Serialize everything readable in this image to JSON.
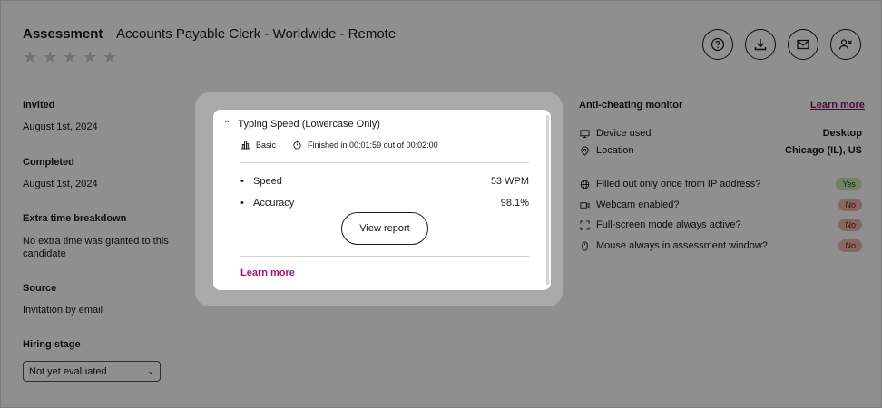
{
  "header": {
    "title": "Assessment",
    "subtitle": "Accounts Payable Clerk - Worldwide - Remote",
    "rating": {
      "value": 0,
      "max": 5
    }
  },
  "actions": [
    {
      "name": "help-icon"
    },
    {
      "name": "download-icon"
    },
    {
      "name": "mail-icon"
    },
    {
      "name": "remove-user-icon"
    }
  ],
  "left": {
    "invited_label": "Invited",
    "invited_value": "August 1st, 2024",
    "completed_label": "Completed",
    "completed_value": "August 1st, 2024",
    "extra_label": "Extra time breakdown",
    "extra_value": "No extra time was granted to this candidate",
    "source_label": "Source",
    "source_value": "Invitation by email",
    "stage_label": "Hiring stage",
    "stage_value": "Not yet evaluated"
  },
  "monitor": {
    "title": "Anti-cheating monitor",
    "learn_more": "Learn more",
    "device_label": "Device used",
    "device_value": "Desktop",
    "location_label": "Location",
    "location_value": "Chicago (IL), US",
    "checks": [
      {
        "label": "Filled out only once from IP address?",
        "value": "Yes",
        "icon": "globe-icon"
      },
      {
        "label": "Webcam enabled?",
        "value": "No",
        "icon": "webcam-icon"
      },
      {
        "label": "Full-screen mode always active?",
        "value": "No",
        "icon": "fullscreen-icon"
      },
      {
        "label": "Mouse always in assessment window?",
        "value": "No",
        "icon": "mouse-icon"
      }
    ]
  },
  "modal": {
    "title": "Typing Speed (Lowercase Only)",
    "level": "Basic",
    "finished": "Finished in 00:01:59 out of 00:02:00",
    "speed_label": "Speed",
    "speed_value": "53 WPM",
    "accuracy_label": "Accuracy",
    "accuracy_value": "98.1%",
    "view_report": "View report",
    "learn_more": "Learn more"
  }
}
